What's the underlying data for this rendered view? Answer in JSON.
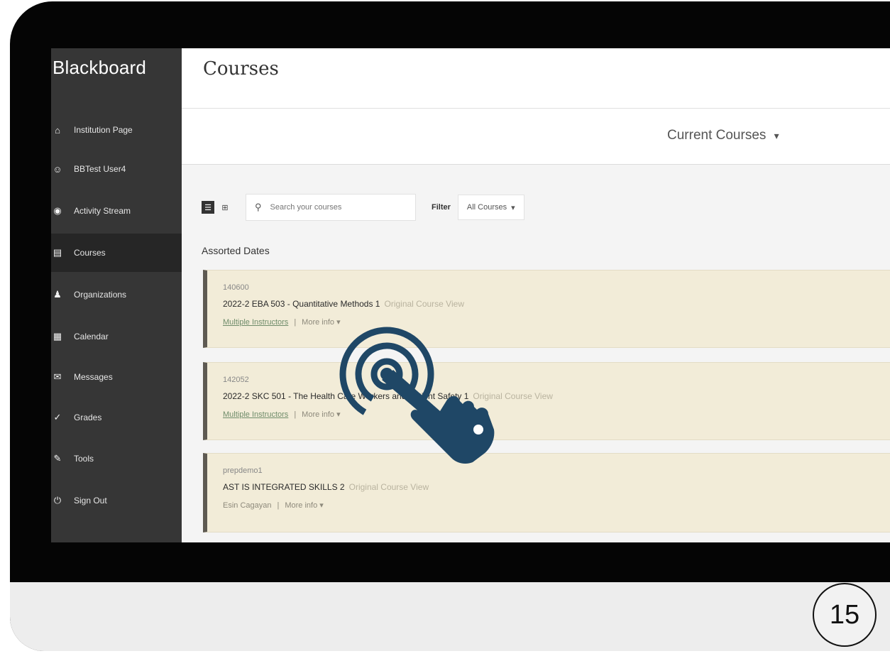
{
  "sidebar": {
    "logo": "Blackboard",
    "items": [
      {
        "label": "Institution Page",
        "icon": "institution-icon",
        "glyph": "⌂"
      },
      {
        "label": "BBTest User4",
        "icon": "user-icon",
        "glyph": "☺"
      },
      {
        "label": "Activity Stream",
        "icon": "activity-stream-icon",
        "glyph": "◉"
      },
      {
        "label": "Courses",
        "icon": "courses-icon",
        "glyph": "▤"
      },
      {
        "label": "Organizations",
        "icon": "organizations-icon",
        "glyph": "♟"
      },
      {
        "label": "Calendar",
        "icon": "calendar-icon",
        "glyph": "▦"
      },
      {
        "label": "Messages",
        "icon": "messages-icon",
        "glyph": "✉"
      },
      {
        "label": "Grades",
        "icon": "grades-icon",
        "glyph": "✓"
      },
      {
        "label": "Tools",
        "icon": "tools-icon",
        "glyph": "✎"
      },
      {
        "label": "Sign Out",
        "icon": "sign-out-icon",
        "glyph": "⏻"
      }
    ],
    "active_index": 3
  },
  "header": {
    "title": "Courses"
  },
  "term_select": {
    "value": "Current Courses",
    "arrow": "▾"
  },
  "toolbar": {
    "list_view_icon": "list-view-icon",
    "grid_view_icon": "grid-view-icon",
    "search_icon": "search-icon",
    "search_placeholder": "Search your courses",
    "filter_label": "Filter",
    "filter_value": "All Courses",
    "filter_arrow": "▾"
  },
  "section": {
    "title": "Assorted Dates"
  },
  "courses": [
    {
      "id": "140600",
      "title": "2022-2 EBA 503 - Quantitative Methods 1",
      "view": "Original Course View",
      "instructors": "Multiple Instructors",
      "sep": "|",
      "more": "More info ▾"
    },
    {
      "id": "142052",
      "title": "2022-2 SKC 501 - The Health Care Workers and Patient Safety 1",
      "view": "Original Course View",
      "instructors": "Multiple Instructors",
      "sep": "|",
      "more": "More info ▾"
    },
    {
      "id": "prepdemo1",
      "title": "AST IS INTEGRATED SKILLS 2",
      "view": "Original Course View",
      "instructors": "Esin Cagayan",
      "sep": "|",
      "more": "More info ▾"
    }
  ],
  "overlay": {
    "icon": "tap-hand-icon",
    "color": "#1f4766"
  },
  "step_badge": {
    "number": "15"
  }
}
